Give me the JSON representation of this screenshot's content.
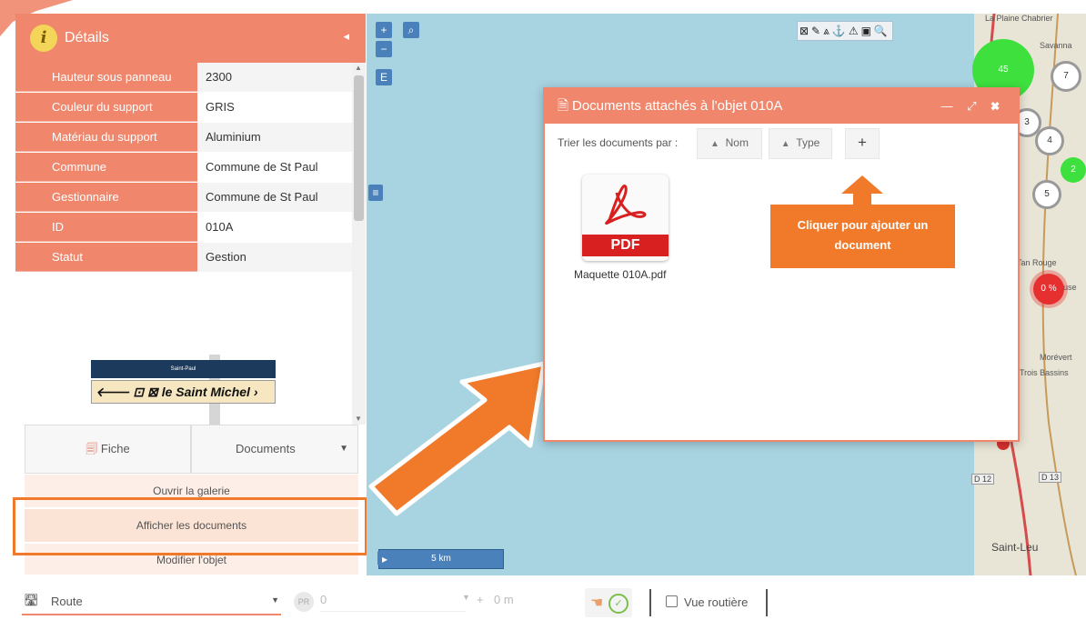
{
  "colors": {
    "accent": "#f0876c",
    "highlight": "#f07a2a",
    "map_water": "#a8d3e1",
    "map_button": "#4b81bb"
  },
  "panel": {
    "title": "Détails",
    "info_icon": "i",
    "collapse_icon": "◂",
    "properties": [
      {
        "label": "Hauteur sous panneau",
        "value": "2300"
      },
      {
        "label": "Couleur du support",
        "value": "GRIS"
      },
      {
        "label": "Matériau du support",
        "value": "Aluminium"
      },
      {
        "label": "Commune",
        "value": "Commune de St Paul"
      },
      {
        "label": "Gestionnaire",
        "value": "Commune de St Paul"
      },
      {
        "label": "ID",
        "value": "010A"
      },
      {
        "label": "Statut",
        "value": "Gestion"
      }
    ],
    "sign": {
      "top_text": "Saint-Paul",
      "destination": "le Saint Michel"
    }
  },
  "tabs": {
    "fiche": "Fiche",
    "documents": "Documents"
  },
  "menu": {
    "open_gallery": "Ouvrir la galerie",
    "show_documents": "Afficher les documents",
    "modify_object": "Modifier l'objet"
  },
  "map": {
    "zoom_in": "+",
    "zoom_out": "−",
    "edit_label": "E",
    "toolbar_icons": "⊠✎⩓⚓⚠▣🔍",
    "places": [
      "La Plaine Chabrier",
      "Savanna",
      "Tan Rouge",
      "Pause",
      "Morévert",
      "Trois Bassins",
      "Saint-Leu",
      "D 12",
      "D 13"
    ],
    "clusters": [
      "45",
      "7",
      "3",
      "4",
      "2",
      "5",
      "0 %"
    ],
    "scale": "5 km"
  },
  "documents_window": {
    "title": "Documents attachés à l'objet 010A",
    "controls": "— ⤢ ✖",
    "sort_label": "Trier les documents par :",
    "sort_name": "Nom",
    "sort_type": "Type",
    "add_button": "+",
    "file_type": "PDF",
    "file_name": "Maquette 010A.pdf"
  },
  "callout": {
    "text_line1": "Cliquer pour ajouter un",
    "text_line2": "document"
  },
  "bottom": {
    "route_label": "Route",
    "pr_badge": "PR",
    "pr_value": "0",
    "plus": "+",
    "distance": "0 m",
    "vue_label": "Vue routière"
  }
}
